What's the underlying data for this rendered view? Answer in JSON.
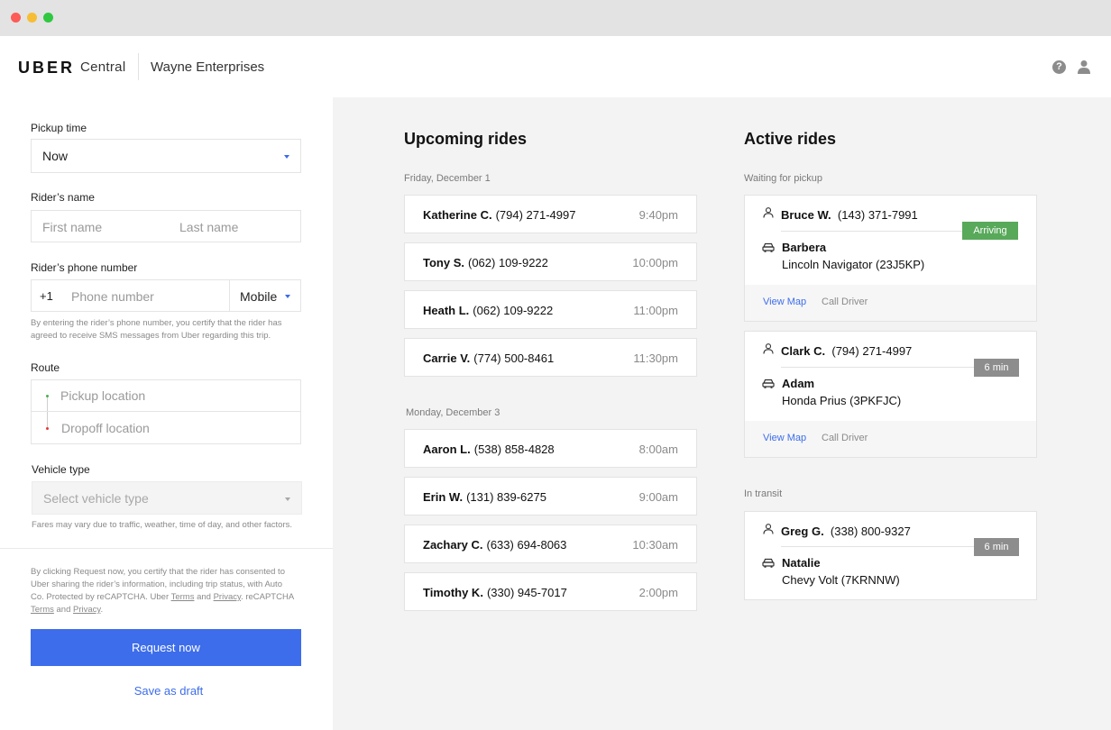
{
  "header": {
    "brand": "UBER",
    "brand_sub": "Central",
    "organization": "Wayne Enterprises"
  },
  "form": {
    "pickup_time_label": "Pickup time",
    "pickup_time_value": "Now",
    "riders_name_label": "Rider’s name",
    "first_name_placeholder": "First name",
    "last_name_placeholder": "Last name",
    "phone_label": "Rider’s phone number",
    "country_code": "+1",
    "phone_placeholder": "Phone number",
    "phone_type": "Mobile",
    "phone_note": "By entering the rider’s phone number, you certify that the rider has agreed to receive SMS messages from Uber regarding this trip.",
    "route_label": "Route",
    "pickup_placeholder": "Pickup location",
    "dropoff_placeholder": "Dropoff location",
    "vehicle_label": "Vehicle type",
    "vehicle_placeholder": "Select vehicle type",
    "fare_note": "Fares may vary due to traffic, weather, time of day, and other factors.",
    "consent_note_1": "By clicking Request now, you certify that the rider has consented to Uber sharing the rider’s information, including trip status, with Auto Co. Protected by reCAPTCHA. Uber ",
    "terms": "Terms",
    "and": " and ",
    "privacy": "Privacy",
    "consent_note_2": ". reCAPTCHA ",
    "terms2": "Terms",
    "privacy2": "Privacy",
    "period": ".",
    "request_button": "Request now",
    "draft_link": "Save as draft"
  },
  "upcoming": {
    "title": "Upcoming rides",
    "groups": [
      {
        "date": "Friday, December 1",
        "rides": [
          {
            "name": "Katherine C.",
            "phone": "(794) 271-4997",
            "time": "9:40pm"
          },
          {
            "name": "Tony S.",
            "phone": "(062) 109-9222",
            "time": "10:00pm"
          },
          {
            "name": "Heath L.",
            "phone": "(062) 109-9222",
            "time": "11:00pm"
          },
          {
            "name": "Carrie V.",
            "phone": "(774) 500-8461",
            "time": "11:30pm"
          }
        ]
      },
      {
        "date": "Monday, December 3",
        "rides": [
          {
            "name": "Aaron L.",
            "phone": "(538) 858-4828",
            "time": "8:00am"
          },
          {
            "name": "Erin W.",
            "phone": "(131) 839-6275",
            "time": "9:00am"
          },
          {
            "name": "Zachary C.",
            "phone": "(633) 694-8063",
            "time": "10:30am"
          },
          {
            "name": "Timothy K.",
            "phone": "(330) 945-7017",
            "time": "2:00pm"
          }
        ]
      }
    ]
  },
  "active": {
    "title": "Active rides",
    "waiting_label": "Waiting for pickup",
    "transit_label": "In transit",
    "view_map": "View Map",
    "call_driver": "Call Driver",
    "rides": [
      {
        "rider": "Bruce W.",
        "phone": "(143) 371-7991",
        "status": "Arriving",
        "driver": "Barbera",
        "vehicle": "Lincoln Navigator (23J5KP)"
      },
      {
        "rider": "Clark C.",
        "phone": "(794) 271-4997",
        "status": "6 min",
        "driver": "Adam",
        "vehicle": "Honda Prius (3PKFJC)"
      },
      {
        "rider": "Greg G.",
        "phone": "(338) 800-9327",
        "status": "6 min",
        "driver": "Natalie",
        "vehicle": "Chevy Volt (7KRNNW)"
      }
    ]
  },
  "colors": {
    "accent": "#3d6deb",
    "arriving": "#58a95a",
    "eta": "#8d8d8d"
  }
}
